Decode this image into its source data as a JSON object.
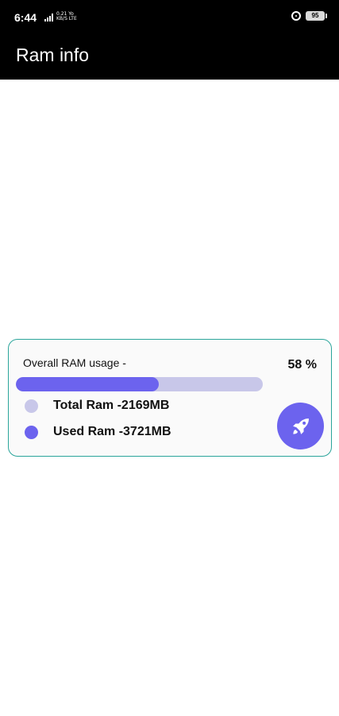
{
  "status_bar": {
    "time": "6:44",
    "network_line1": "0.21 Yo",
    "network_line2": "KB/S LTE",
    "battery": "95",
    "icons": [
      "signal-icon",
      "alarm-icon",
      "battery-icon"
    ]
  },
  "app_bar": {
    "title": "Ram info"
  },
  "ram_card": {
    "label": "Overall RAM usage -",
    "percent_text": "58 %",
    "usage_percent": 58,
    "total_text": "Total Ram -2169MB",
    "used_text": "Used Ram -3721MB",
    "boost_icon": "rocket-icon",
    "colors": {
      "accent": "#6c63ee",
      "track": "#c8c7e9",
      "border": "#2ba59b"
    }
  }
}
